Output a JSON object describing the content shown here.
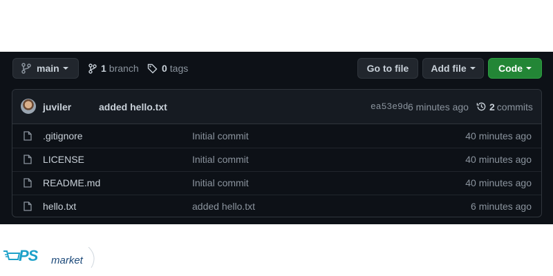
{
  "toolbar": {
    "branch_label": "main",
    "branch_count": "1",
    "branch_word": "branch",
    "tag_count": "0",
    "tag_word": "tags",
    "goto_label": "Go to file",
    "add_label": "Add file",
    "code_label": "Code"
  },
  "commit": {
    "author": "juviler",
    "message": "added hello.txt",
    "sha": "ea53e9d",
    "time": "6 minutes ago",
    "count": "2",
    "count_word": "commits"
  },
  "files": [
    {
      "name": ".gitignore",
      "message": "Initial commit",
      "age": "40 minutes ago"
    },
    {
      "name": "LICENSE",
      "message": "Initial commit",
      "age": "40 minutes ago"
    },
    {
      "name": "README.md",
      "message": "Initial commit",
      "age": "40 minutes ago"
    },
    {
      "name": "hello.txt",
      "message": "added hello.txt",
      "age": "6 minutes ago"
    }
  ],
  "watermark": {
    "brand": "PS",
    "sub": "market"
  },
  "colors": {
    "background": "#0d1117",
    "code_button": "#238636",
    "border": "#30363d"
  }
}
